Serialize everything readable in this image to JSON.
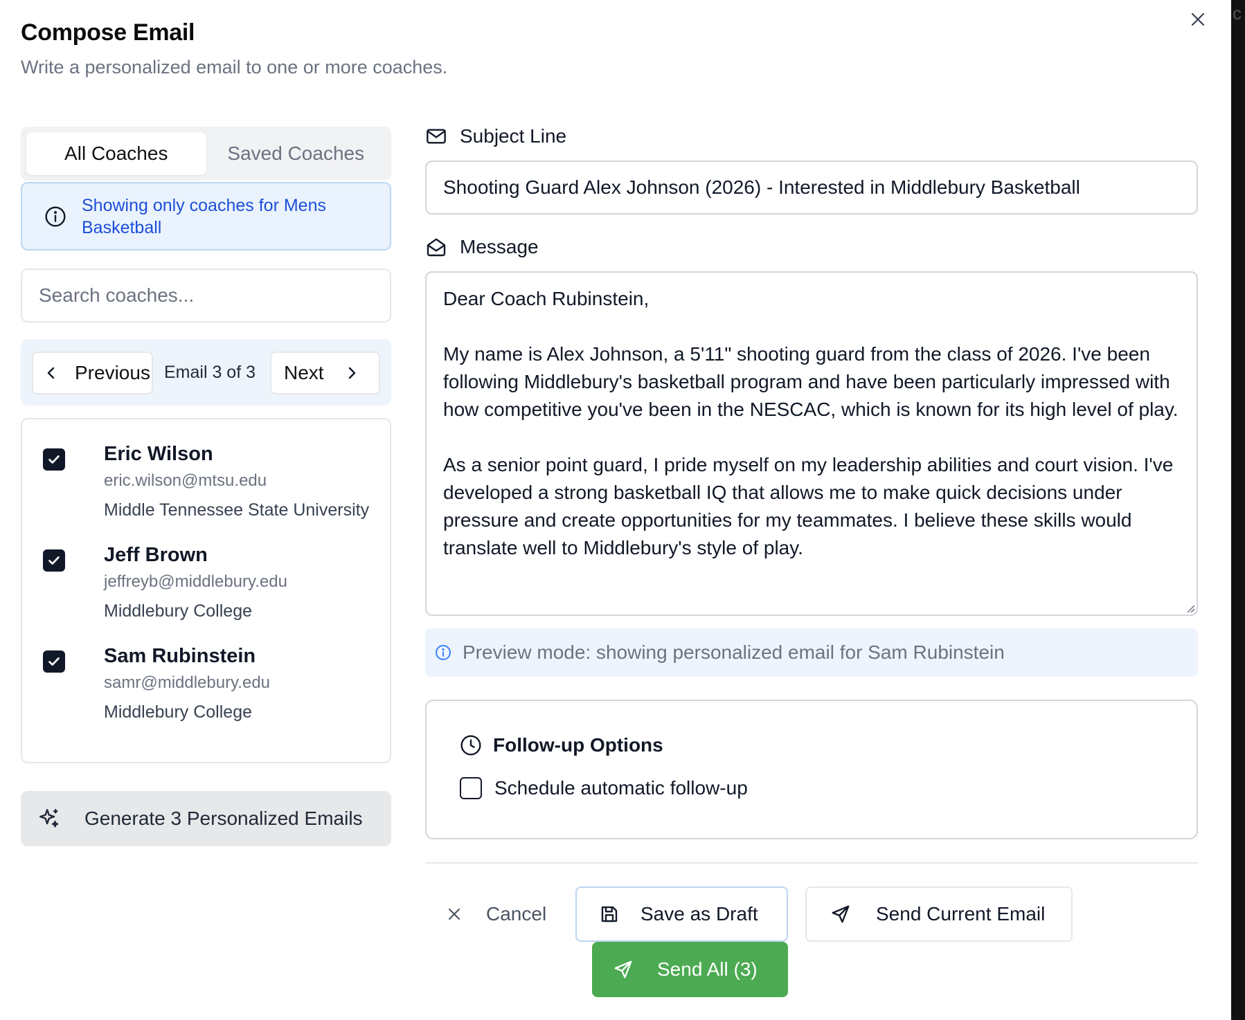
{
  "modal": {
    "title": "Compose Email",
    "subtitle": "Write a personalized email to one or more coaches."
  },
  "tabs": [
    {
      "label": "All Coaches",
      "active": true
    },
    {
      "label": "Saved Coaches",
      "active": false
    }
  ],
  "info": {
    "text": "Showing only coaches for Mens Basketball",
    "icon": "info-circle-icon"
  },
  "search": {
    "placeholder": "Search coaches...",
    "value": ""
  },
  "pager": {
    "prev_label": "Previous",
    "next_label": "Next",
    "count_text": "Email 3 of 3"
  },
  "coaches": [
    {
      "name": "Eric Wilson",
      "email": "eric.wilson@mtsu.edu",
      "school": "Middle Tennessee State University",
      "checked": true
    },
    {
      "name": "Jeff Brown",
      "email": "jeffreyb@middlebury.edu",
      "school": "Middlebury College",
      "checked": true
    },
    {
      "name": "Sam Rubinstein",
      "email": "samr@middlebury.edu",
      "school": "Middlebury College",
      "checked": true
    }
  ],
  "generate_button": {
    "label": "Generate 3 Personalized Emails",
    "icon": "sparkles-icon"
  },
  "subject": {
    "label": "Subject Line",
    "icon": "mail-icon",
    "value": "Shooting Guard Alex Johnson (2026) - Interested in Middlebury Basketball"
  },
  "message": {
    "label": "Message",
    "icon": "mail-open-icon",
    "value": "Dear Coach Rubinstein,\n\nMy name is Alex Johnson, a 5'11\" shooting guard from the class of 2026. I've been following Middlebury's basketball program and have been particularly impressed with how competitive you've been in the NESCAC, which is known for its high level of play.\n\nAs a senior point guard, I pride myself on my leadership abilities and court vision. I've developed a strong basketball IQ that allows me to make quick decisions under pressure and create opportunities for my teammates. I believe these skills would translate well to Middlebury's style of play."
  },
  "preview": {
    "text": "Preview mode: showing personalized email for Sam Rubinstein"
  },
  "followup": {
    "heading": "Follow-up Options",
    "option_label": "Schedule automatic follow-up",
    "checked": false
  },
  "actions": {
    "cancel": "Cancel",
    "save_draft": "Save as Draft",
    "send_current": "Send Current Email",
    "send_all": "Send All (3)"
  },
  "colors": {
    "send_all_bg": "#4caa52",
    "info_bg": "#eaf3fd",
    "info_text": "#1d4ed8",
    "checkbox": "#111827"
  }
}
